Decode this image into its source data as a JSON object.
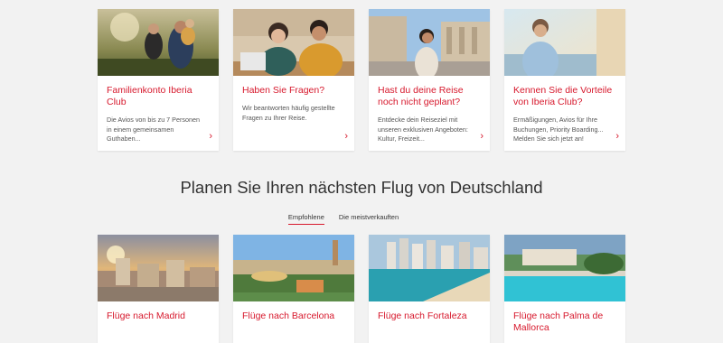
{
  "top_cards": [
    {
      "title": "Familienkonto Iberia Club",
      "text": "Die Avios von bis zu 7 Personen in einem gemeinsamen Guthaben..."
    },
    {
      "title": "Haben Sie Fragen?",
      "text": "Wir beantworten häufig gestellte Fragen zu Ihrer Reise."
    },
    {
      "title": "Hast du deine Reise noch nicht geplant?",
      "text": "Entdecke dein Reiseziel mit unseren exklusiven Angeboten: Kultur, Freizeit..."
    },
    {
      "title": "Kennen Sie die Vorteile von Iberia Club?",
      "text": "Ermäßigungen, Avios für Ihre Buchungen, Priority Boarding... Melden Sie sich jetzt an!"
    }
  ],
  "chevron": "›",
  "section_heading": "Planen Sie Ihren nächsten Flug von Deutschland",
  "tabs": [
    "Empfohlene",
    "Die meistverkauften"
  ],
  "bottom_cards": [
    {
      "title": "Flüge nach Madrid"
    },
    {
      "title": "Flüge nach Barcelona"
    },
    {
      "title": "Flüge nach Fortaleza"
    },
    {
      "title": "Flüge nach Palma de Mallorca"
    }
  ],
  "colors": {
    "accent": "#d7192d",
    "background": "#f2f2f2"
  }
}
